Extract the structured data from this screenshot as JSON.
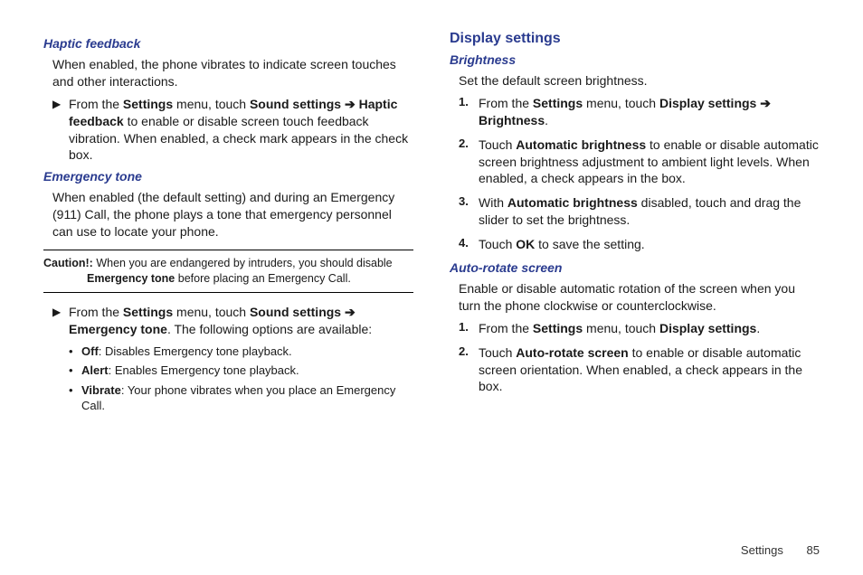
{
  "left": {
    "haptic": {
      "heading": "Haptic feedback",
      "intro": "When enabled, the phone vibrates to indicate screen touches and other interactions.",
      "step_html": "From the <b>Settings</b> menu, touch <b>Sound settings</b> <span class='rarr'>➔</span> <b>Haptic feedback</b> to enable or disable screen touch feedback vibration. When enabled, a check mark appears in the check box."
    },
    "emergency": {
      "heading": "Emergency tone",
      "intro": "When enabled (the default setting) and during an Emergency (911) Call, the phone plays a tone that emergency personnel can use to locate your phone.",
      "caution_html": "<span class='caution-label'>Caution!:</span> When you are endangered by intruders, you should disable <span class='caution-indent'><b>Emergency tone</b> before placing an Emergency Call.</span>",
      "step_html": "From the <b>Settings</b> menu, touch <b>Sound settings</b> <span class='rarr'>➔</span> <b>Emergency tone</b>. The following options are available:",
      "bullets": [
        "<b>Off</b>: Disables Emergency tone playback.",
        "<b>Alert</b>: Enables Emergency tone playback.",
        "<b>Vibrate</b>: Your phone vibrates when you place an Emergency Call."
      ]
    }
  },
  "right": {
    "display_heading": "Display settings",
    "brightness": {
      "heading": "Brightness",
      "intro": "Set the default screen brightness.",
      "steps": [
        "From the <b>Settings</b> menu, touch <b>Display settings</b> <span class='rarr'>➔</span> <b>Brightness</b>.",
        "Touch <b>Automatic brightness</b> to enable or disable automatic screen brightness adjustment to ambient light levels. When enabled, a check appears in the box.",
        "With <b>Automatic brightness</b> disabled, touch and drag the slider to set the brightness.",
        "Touch <b>OK</b> to save the setting."
      ]
    },
    "autorotate": {
      "heading": "Auto-rotate screen",
      "intro": "Enable or disable automatic rotation of the screen when you turn the phone clockwise or counterclockwise.",
      "steps": [
        "From the <b>Settings</b> menu, touch <b>Display settings</b>.",
        "Touch <b>Auto-rotate screen</b> to enable or disable automatic screen orientation. When enabled, a check appears in the box."
      ]
    }
  },
  "footer": {
    "section": "Settings",
    "page": "85"
  },
  "glyphs": {
    "arrow": "▶"
  }
}
